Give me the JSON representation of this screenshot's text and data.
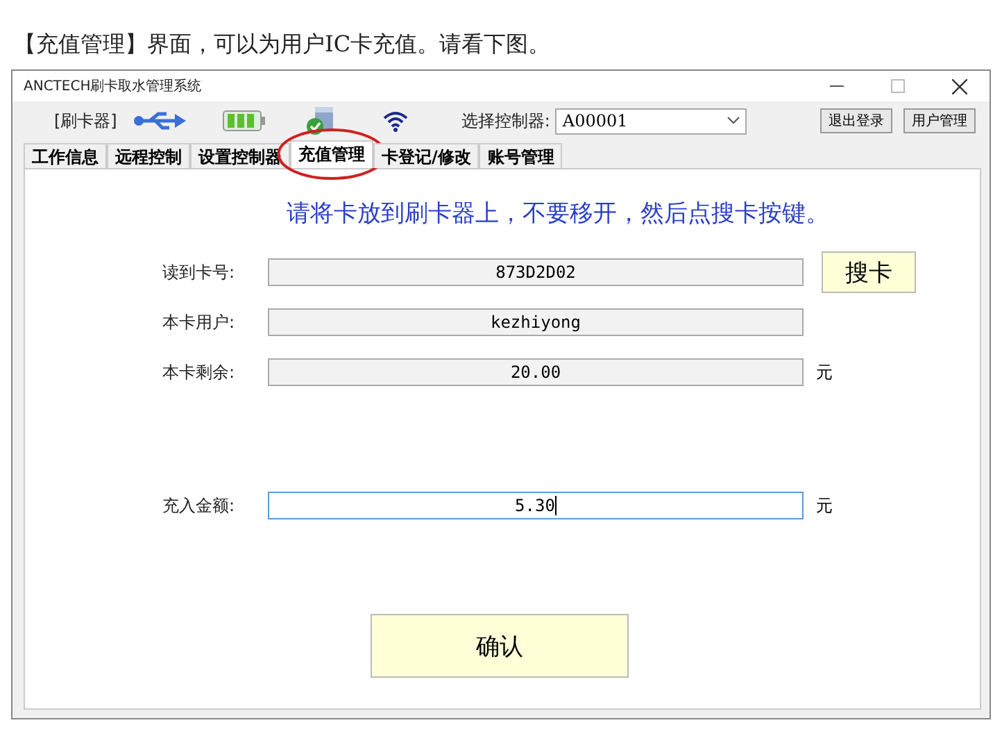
{
  "caption": "【充值管理】界面，可以为用户IC卡充值。请看下图。",
  "window": {
    "title": "ANCTECH刷卡取水管理系统"
  },
  "toolbar": {
    "reader_label": "[刷卡器]",
    "controller_label": "选择控制器:",
    "controller_value": "A00001",
    "buttons": [
      "退出登录",
      "用户管理"
    ]
  },
  "tabs": [
    {
      "label": "工作信息",
      "selected": false
    },
    {
      "label": "远程控制",
      "selected": false
    },
    {
      "label": "设置控制器",
      "selected": false
    },
    {
      "label": "充值管理",
      "selected": true
    },
    {
      "label": "卡登记/修改",
      "selected": false
    },
    {
      "label": "账号管理",
      "selected": false
    }
  ],
  "instruction": "请将卡放到刷卡器上，不要移开，然后点搜卡按键。",
  "fields": [
    {
      "label": "读到卡号:",
      "value": "873D2D02",
      "focused": false,
      "button": "搜卡"
    },
    {
      "label": "本卡用户:",
      "value": "kezhiyong",
      "focused": false
    },
    {
      "label": "本卡剩余:",
      "value": "20.00",
      "focused": false,
      "unit": "元"
    },
    {
      "label": "充入金额:",
      "value": "5.30",
      "focused": true,
      "unit": "元"
    }
  ],
  "confirm_button": "确认"
}
